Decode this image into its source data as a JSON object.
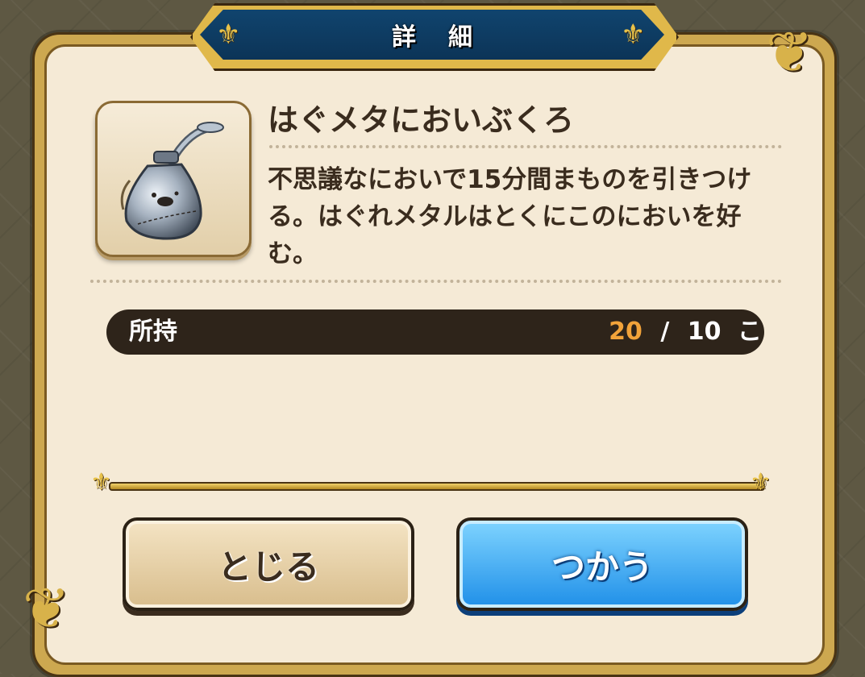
{
  "dialog": {
    "title": "詳細",
    "item_name": "はぐメタにおいぶくろ",
    "item_icon": "pouch-bottle-icon",
    "description": "不思議なにおいで15分間まものを引きつける。はぐれメタルはとくにこのにおいを好む。",
    "owned": {
      "label": "所持",
      "current": "20",
      "separator": "/",
      "max": "10",
      "unit": "こ"
    },
    "buttons": {
      "close_label": "とじる",
      "use_label": "つかう"
    }
  },
  "colors": {
    "banner_blue": "#0c3457",
    "gold": "#cda850",
    "panel": "#f5ead6",
    "owned_highlight": "#f2a33a",
    "use_button": "#1f8fe8"
  }
}
